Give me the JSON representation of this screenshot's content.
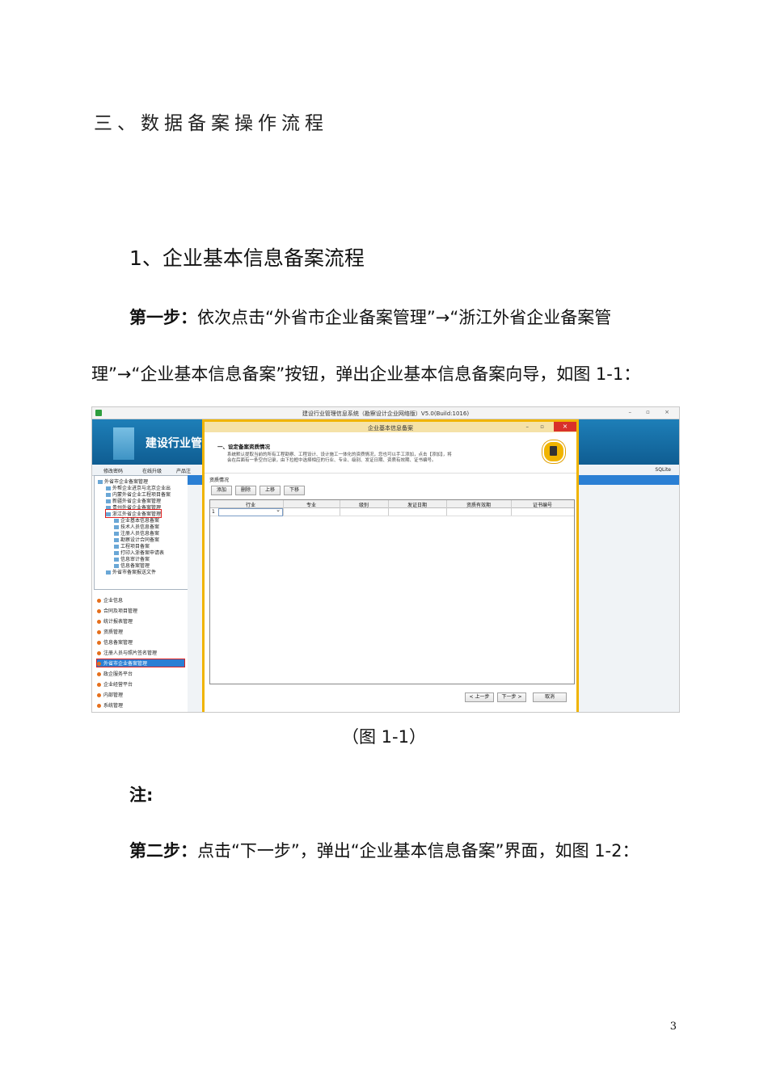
{
  "document": {
    "section_heading": "三、数据备案操作流程",
    "sub_heading": "1、企业基本信息备案流程",
    "step1": {
      "label": "第一步：",
      "text_line1": "依次点击“外省市企业备案管理”→“浙江外省企业备案管",
      "text_line2": "理”→“企业基本信息备案”按钮，弹出企业基本信息备案向导，如图 1-1："
    },
    "caption": "（图 1-1）",
    "note_label": "注:",
    "step2": {
      "label": "第二步：",
      "text": "点击“下一步”，弹出“企业基本信息备案”界面，如图 1-2："
    },
    "page_number": "3"
  },
  "screenshot": {
    "window_title": "建设行业管理信息系统（勘察设计企业网络版）V5.0(Build:1016)",
    "banner_text": "建设行业管",
    "toolbar": [
      "修改密码",
      "在线升级",
      "产品注"
    ],
    "sqlite_label": "SQLite",
    "tree_items": [
      "外省市企业备案管理",
      "外帮企业进京与北京企业出",
      "内蒙外省企业工程项目备案",
      "新疆外省企业备案管理",
      "贵州外省企业备案管理",
      "浙江外省企业备案管理",
      "企业基本信息备案",
      "技术人员信息备案",
      "注册人员信息备案",
      "勘察设计合同备案",
      "工程项目备案",
      "打印入浙备案申请表",
      "信息审计备案",
      "信息备案管理",
      "外省市备案报送文件"
    ],
    "nav_items": [
      "企业信息",
      "合同及项目管理",
      "统计报表管理",
      "资质管理",
      "信息备案管理",
      "注册人员与照片签名管理",
      "外省市企业备案管理",
      "政企服务平台",
      "企业经营平台",
      "内部管理",
      "系统管理"
    ],
    "right_labels": [
      "基",
      "基本"
    ],
    "dialog": {
      "title": "企业基本信息备案",
      "heading": "一、设定备案资质情况",
      "description": "系统默认提取当前的所有工程勘察、工程设计、设计施工一体化的资质情况，您也可以手工添加，点击【添加】，将会在后面有一条空白记录，由下拉框中选择相应的行业、专业、级别、发证日期、资质有效期、证书编号。",
      "group_label": "资质情况",
      "buttons": [
        "添加",
        "删除",
        "上移",
        "下移"
      ],
      "columns": [
        "行业",
        "专业",
        "级别",
        "发证日期",
        "资质有效期",
        "证书编号"
      ],
      "row_number": "1",
      "footer_buttons": [
        "< 上一步",
        "下一步 >",
        "取消"
      ]
    }
  }
}
